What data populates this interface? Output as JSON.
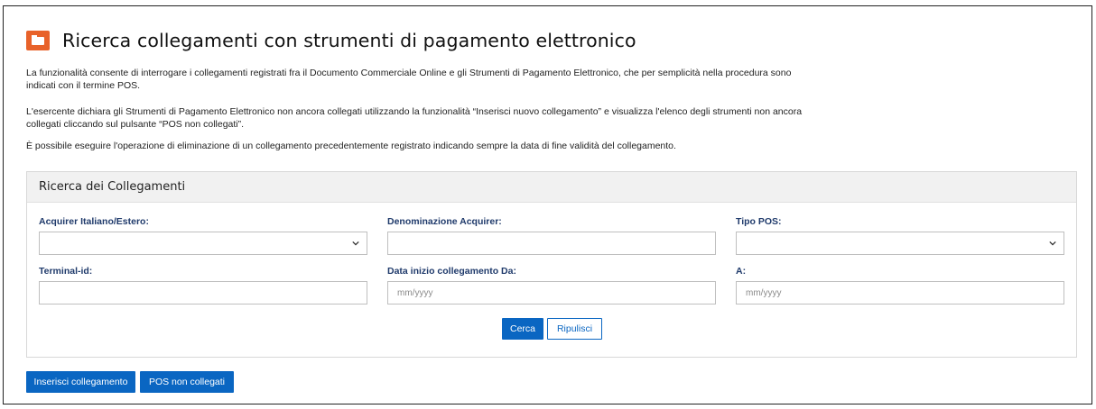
{
  "page": {
    "title": "Ricerca collegamenti con strumenti di pagamento elettronico",
    "paragraphs": [
      "La funzionalità consente di interrogare i collegamenti registrati fra il Documento Commerciale Online e gli Strumenti di Pagamento Elettronico, che per semplicità nella procedura sono indicati con il termine POS.",
      "L'esercente dichiara gli Strumenti di Pagamento Elettronico non ancora collegati utilizzando la funzionalità “Inserisci nuovo collegamento” e visualizza l'elenco degli strumenti non ancora collegati cliccando sul pulsante “POS non collegati”.",
      "È possibile eseguire l'operazione di eliminazione di un collegamento precedentemente registrato indicando sempre la data di fine validità del collegamento."
    ]
  },
  "search_panel": {
    "title": "Ricerca dei Collegamenti",
    "fields": {
      "acquirer_label": "Acquirer Italiano/Estero:",
      "acquirer_value": "",
      "denominazione_label": "Denominazione Acquirer:",
      "denominazione_value": "",
      "tipo_pos_label": "Tipo POS:",
      "tipo_pos_value": "",
      "terminal_label": "Terminal-id:",
      "terminal_value": "",
      "data_da_label": "Data inizio collegamento Da:",
      "data_da_placeholder": "mm/yyyy",
      "data_a_label": "A:",
      "data_a_placeholder": "mm/yyyy"
    },
    "buttons": {
      "search": "Cerca",
      "reset": "Ripulisci"
    }
  },
  "actions": {
    "insert": "Inserisci collegamento",
    "pos_unlinked": "POS non collegati"
  },
  "colors": {
    "accent": "#0a66c2",
    "icon": "#e8622a",
    "label": "#1f3a6b"
  },
  "icons": {
    "title": "folder-icon",
    "select": "chevron-down-icon"
  }
}
